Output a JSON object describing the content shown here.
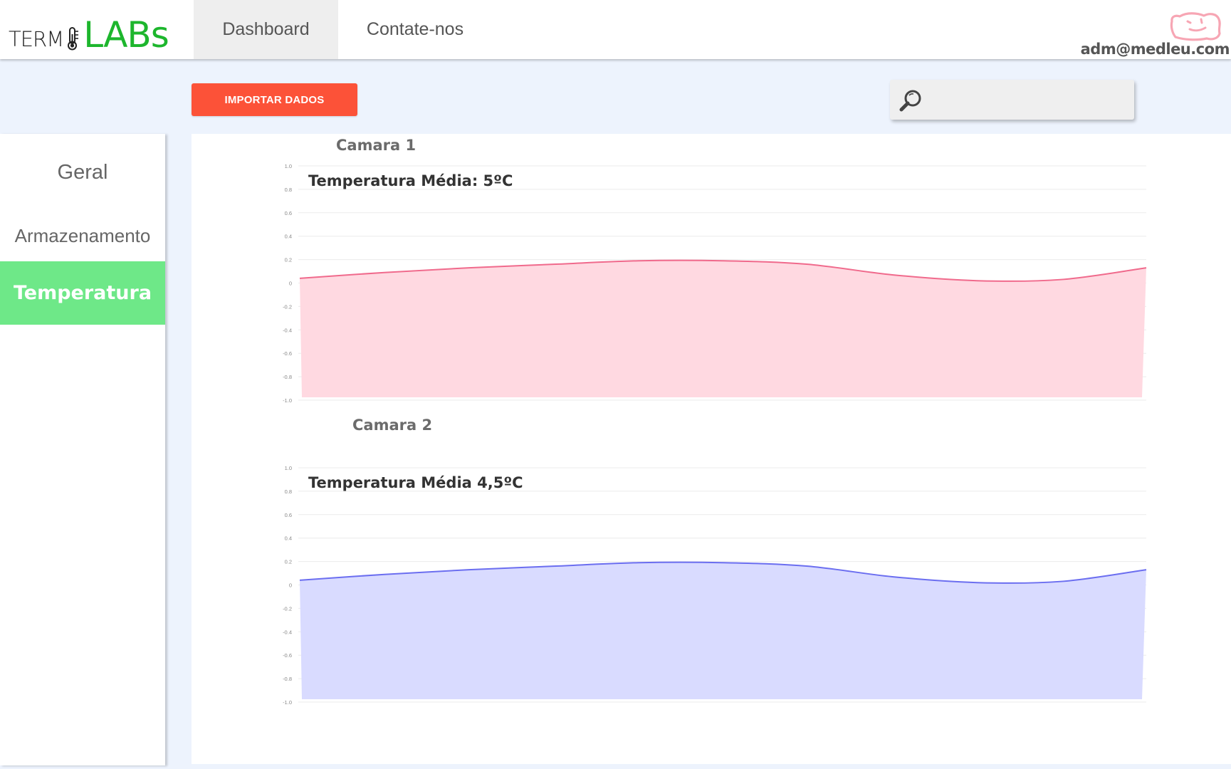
{
  "header": {
    "logo": {
      "part1": "TERM",
      "part2": "LABs"
    },
    "nav": [
      {
        "label": "Dashboard",
        "active": true
      },
      {
        "label": "Contate-nos",
        "active": false
      }
    ],
    "user_email": "adm@medleu.com"
  },
  "toolbar": {
    "import_label": "IMPORTAR DADOS",
    "search_value": ""
  },
  "sidebar": {
    "items": [
      {
        "label": "Geral",
        "active": false
      },
      {
        "label": "Armazenamento",
        "active": false
      },
      {
        "label": "Temperatura",
        "active": true
      }
    ]
  },
  "colors": {
    "accent_button": "#fc5238",
    "sidebar_active": "#6ee888",
    "logo_green": "#1db62d",
    "camara1_line": "#f06a8c",
    "camara1_fill": "#ffd9e1",
    "camara2_line": "#6b6ef0",
    "camara2_fill": "#d9dbff"
  },
  "cameras": [
    {
      "title": "Camara 1",
      "chart_title": "Temperatura Média: 5ºC"
    },
    {
      "title": "Camara 2",
      "chart_title": "Temperatura Média 4,5ºC"
    }
  ],
  "chart_data": [
    {
      "type": "area",
      "title": "Temperatura Média: 5ºC",
      "ylim": [
        -1.0,
        1.0
      ],
      "yticks": [
        "1.0",
        "0.8",
        "0.6",
        "0.4",
        "0.2",
        "0",
        "-0.2",
        "-0.4",
        "-0.6",
        "-0.8",
        "-1.0"
      ],
      "x": [
        0,
        1,
        2,
        3,
        4,
        5,
        6,
        7,
        8,
        9,
        10
      ],
      "series": [
        {
          "values": [
            0.04,
            0.09,
            0.13,
            0.16,
            0.19,
            0.19,
            0.16,
            0.07,
            0.02,
            0.03,
            0.13
          ]
        }
      ],
      "grid": true
    },
    {
      "type": "area",
      "title": "Temperatura Média 4,5ºC",
      "ylim": [
        -1.0,
        1.0
      ],
      "yticks": [
        "1.0",
        "0.8",
        "0.6",
        "0.4",
        "0.2",
        "0",
        "-0.2",
        "-0.4",
        "-0.6",
        "-0.8",
        "-1.0"
      ],
      "x": [
        0,
        1,
        2,
        3,
        4,
        5,
        6,
        7,
        8,
        9,
        10
      ],
      "series": [
        {
          "values": [
            0.04,
            0.09,
            0.13,
            0.16,
            0.19,
            0.19,
            0.16,
            0.07,
            0.02,
            0.03,
            0.13
          ]
        }
      ],
      "grid": true
    }
  ]
}
